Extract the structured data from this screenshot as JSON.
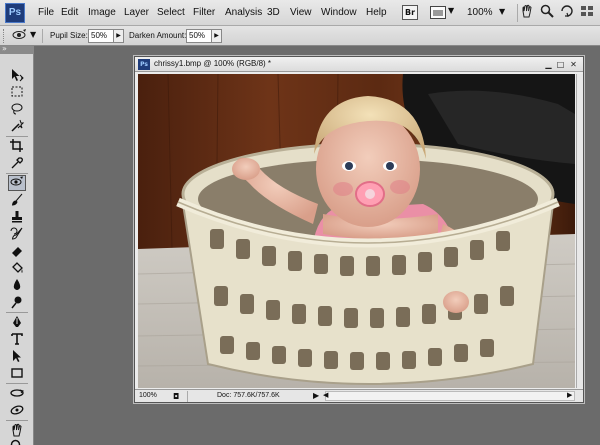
{
  "app": {
    "logo": "Ps"
  },
  "menu": [
    "File",
    "Edit",
    "Image",
    "Layer",
    "Select",
    "Filter",
    "Analysis",
    "3D",
    "View",
    "Window",
    "Help"
  ],
  "menubar_right": {
    "bridge_label": "Br",
    "zoom": "100%",
    "tools": [
      "hand-icon",
      "zoom-icon",
      "rotate-view-icon",
      "arrange-icon"
    ]
  },
  "options": {
    "tool_icon": "red-eye-icon",
    "pupil_size_label": "Pupil Size:",
    "pupil_size_value": "50%",
    "darken_label": "Darken Amount:",
    "darken_value": "50%"
  },
  "tools": [
    "move-icon",
    "marquee-icon",
    "lasso-icon",
    "quick-select-icon",
    "crop-icon",
    "eyedropper-icon",
    "red-eye-icon",
    "brush-icon",
    "clone-stamp-icon",
    "history-brush-icon",
    "eraser-icon",
    "paint-bucket-icon",
    "blur-icon",
    "dodge-icon",
    "pen-icon",
    "type-icon",
    "path-select-icon",
    "shape-icon",
    "3d-rotate-icon",
    "3d-orbit-icon",
    "hand-icon",
    "zoom-icon"
  ],
  "document": {
    "title": "chrissy1.bmp @ 100% (RGB/8) *",
    "zoom": "100%",
    "doc_size": "Doc: 757.6K/757.6K"
  }
}
